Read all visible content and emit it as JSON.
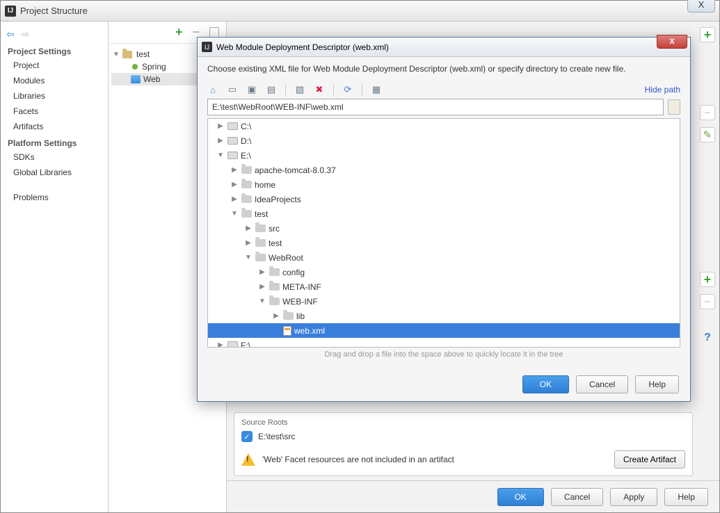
{
  "window": {
    "title": "Project Structure",
    "close_glyph": "X"
  },
  "leftnav": {
    "section1": "Project Settings",
    "items1": [
      "Project",
      "Modules",
      "Libraries",
      "Facets",
      "Artifacts"
    ],
    "section2": "Platform Settings",
    "items2": [
      "SDKs",
      "Global Libraries"
    ],
    "problems": "Problems"
  },
  "tree_mid": {
    "root": "test",
    "spring": "Spring",
    "web": "Web"
  },
  "source_roots": {
    "header": "Source Roots",
    "checked_path": "E:\\test\\src",
    "warning": "'Web' Facet resources are not included in an artifact",
    "create_artifact": "Create Artifact"
  },
  "buttons": {
    "ok": "OK",
    "cancel": "Cancel",
    "apply": "Apply",
    "help": "Help"
  },
  "modal": {
    "title": "Web Module Deployment Descriptor (web.xml)",
    "instruction": "Choose existing XML file for Web Module Deployment Descriptor (web.xml) or specify directory to create new file.",
    "hide_path": "Hide path",
    "path_value": "E:\\test\\WebRoot\\WEB-INF\\web.xml",
    "hint": "Drag and drop a file into the space above to quickly locate it in the tree",
    "ok": "OK",
    "cancel": "Cancel",
    "help": "Help",
    "tree": {
      "c": "C:\\",
      "d": "D:\\",
      "e": "E:\\",
      "apache": "apache-tomcat-8.0.37",
      "home": "home",
      "ideap": "IdeaProjects",
      "test": "test",
      "src": "src",
      "test2": "test",
      "webroot": "WebRoot",
      "config": "config",
      "metainf": "META-INF",
      "webinf": "WEB-INF",
      "lib": "lib",
      "webxml": "web.xml",
      "f": "F:\\"
    }
  }
}
